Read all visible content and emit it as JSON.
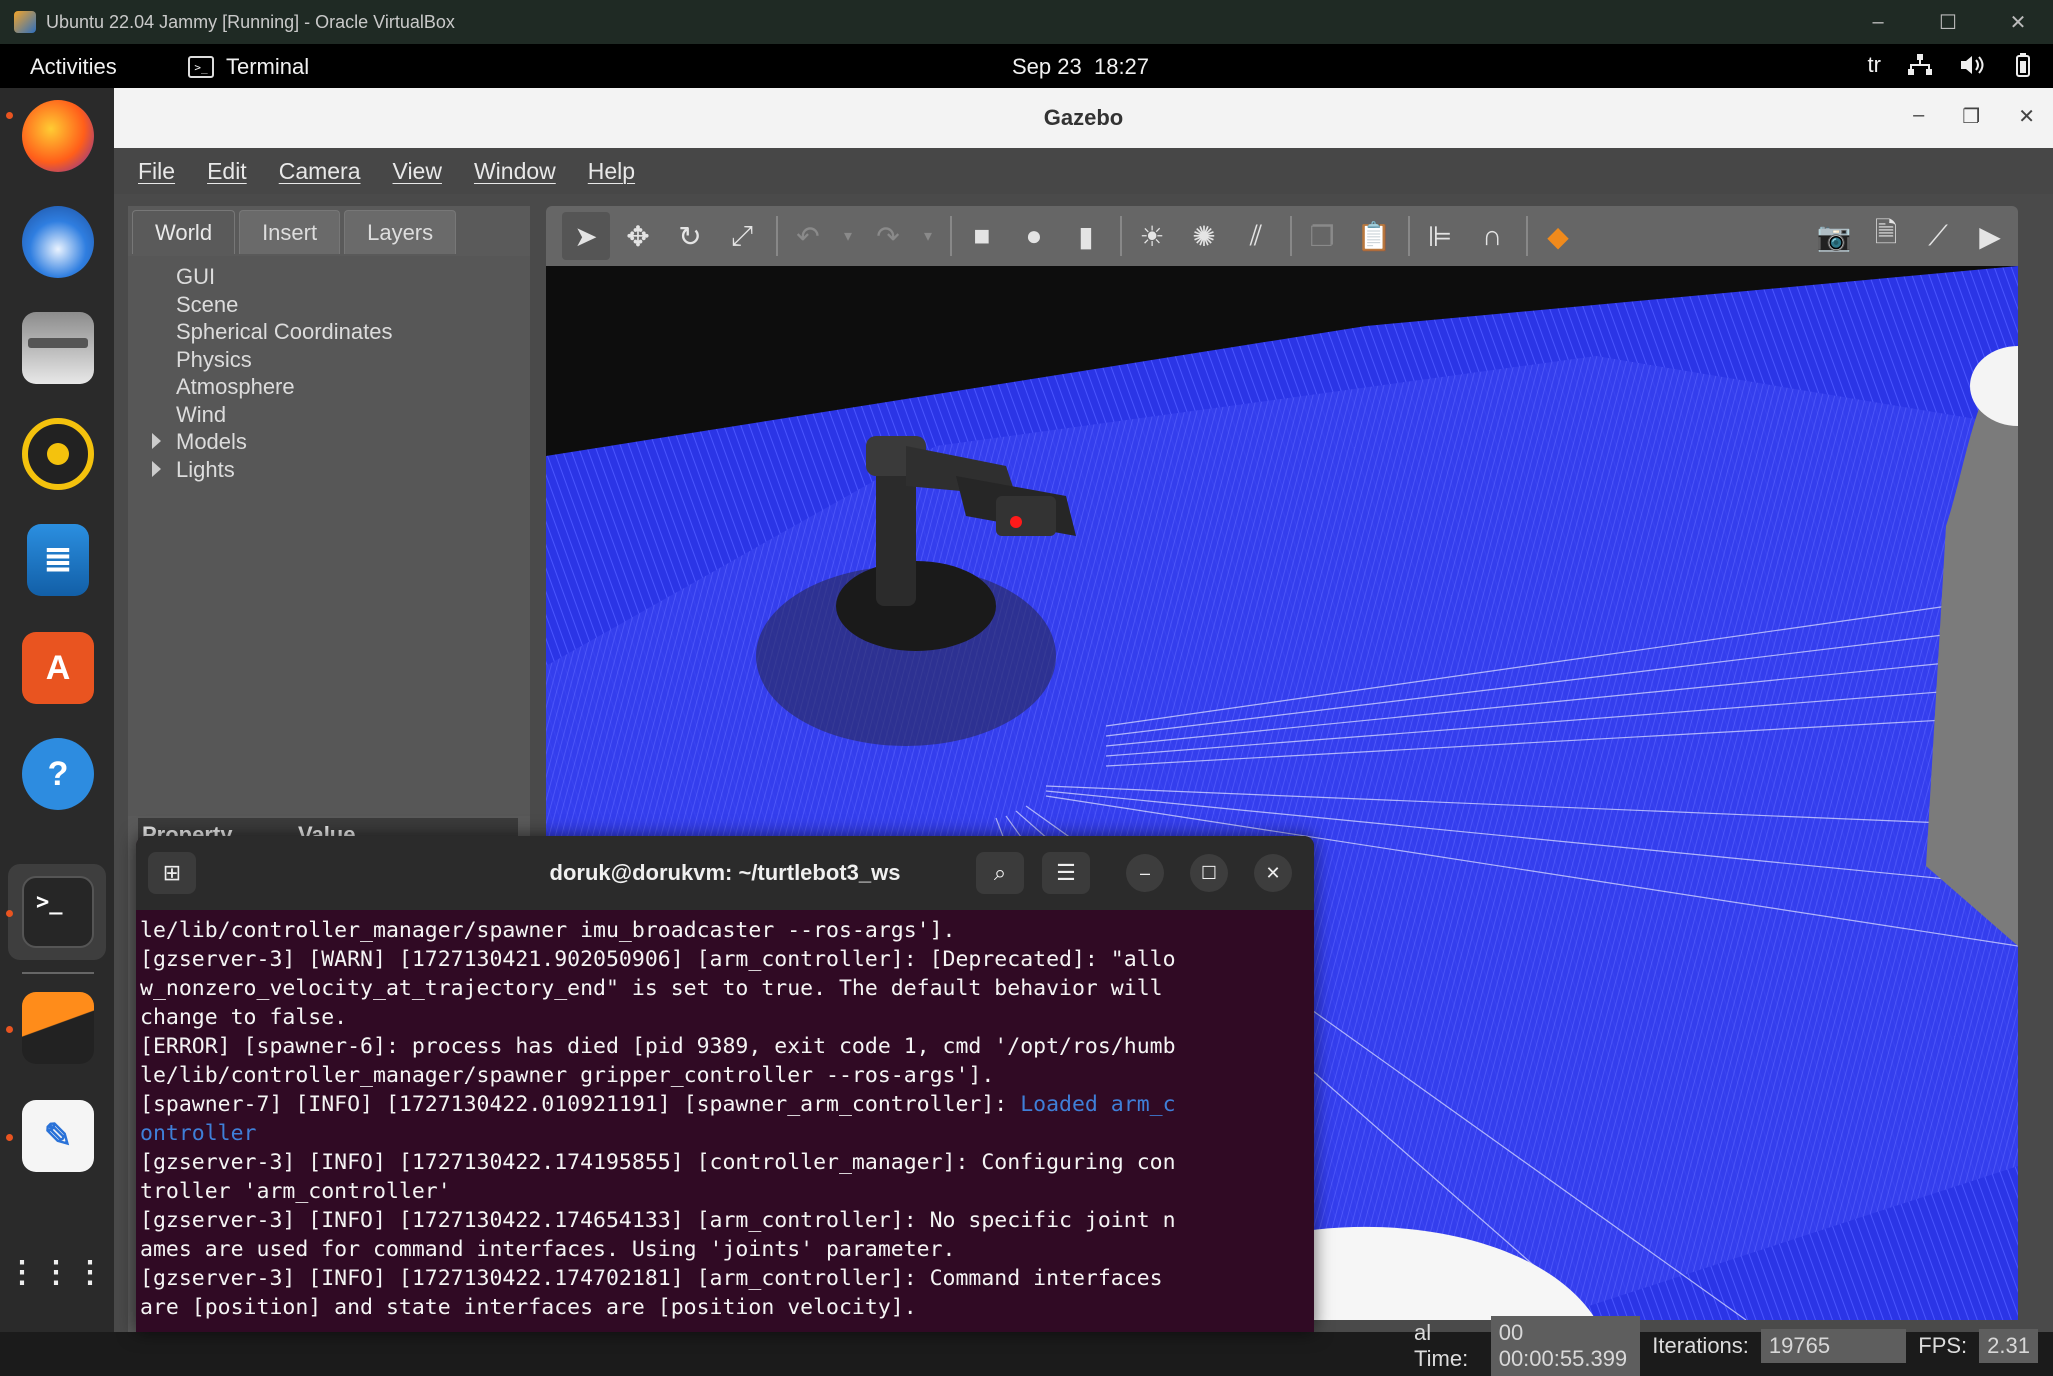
{
  "vbox": {
    "title": "Ubuntu 22.04 Jammy [Running] - Oracle VirtualBox",
    "minimize": "–",
    "maximize": "☐",
    "close": "✕"
  },
  "topbar": {
    "activities": "Activities",
    "app_name": "Terminal",
    "date": "Sep 23",
    "time": "18:27",
    "keyboard_layout": "tr"
  },
  "dock": {
    "items": [
      "firefox",
      "thunderbird",
      "files",
      "rhythmbox",
      "libreoffice-writer",
      "app-center",
      "help",
      "terminal",
      "sublime-merge",
      "text-editor",
      "show-apps"
    ]
  },
  "gazebo": {
    "title": "Gazebo",
    "menu": [
      "File",
      "Edit",
      "Camera",
      "View",
      "Window",
      "Help"
    ],
    "tabs": [
      "World",
      "Insert",
      "Layers"
    ],
    "tree": [
      "GUI",
      "Scene",
      "Spherical Coordinates",
      "Physics",
      "Atmosphere",
      "Wind",
      "Models",
      "Lights"
    ],
    "property_col": "Property",
    "value_col": "Value",
    "status": {
      "real_time_label": "al Time:",
      "real_time_value": "00 00:00:55.399",
      "iterations_label": "Iterations:",
      "iterations_value": "19765",
      "fps_label": "FPS:",
      "fps_value": "2.31"
    }
  },
  "terminal": {
    "title": "doruk@dorukvm: ~/turtlebot3_ws",
    "lines": [
      "le/lib/controller_manager/spawner imu_broadcaster --ros-args'].",
      "[gzserver-3] [WARN] [1727130421.902050906] [arm_controller]: [Deprecated]: \"allo",
      "w_nonzero_velocity_at_trajectory_end\" is set to true. The default behavior will",
      "change to false.",
      "[ERROR] [spawner-6]: process has died [pid 9389, exit code 1, cmd '/opt/ros/humb",
      "le/lib/controller_manager/spawner gripper_controller --ros-args'].",
      "[spawner-7] [INFO] [1727130422.010921191] [spawner_arm_controller]: ",
      "ontroller",
      "[gzserver-3] [INFO] [1727130422.174195855] [controller_manager]: Configuring con",
      "troller 'arm_controller'",
      "[gzserver-3] [INFO] [1727130422.174654133] [arm_controller]: No specific joint n",
      "ames are used for command interfaces. Using 'joints' parameter.",
      "[gzserver-3] [INFO] [1727130422.174702181] [arm_controller]: Command interfaces",
      "are [position] and state interfaces are [position velocity]."
    ],
    "loaded_text": "Loaded arm_c"
  }
}
